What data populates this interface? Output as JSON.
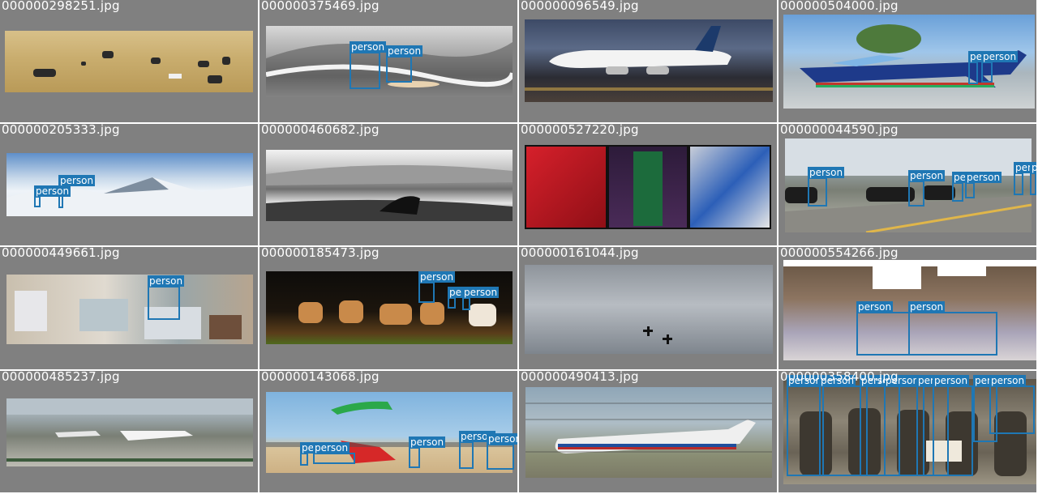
{
  "box_color": "#1f77b4",
  "cells": [
    {
      "filename": "000000298251.jpg",
      "detections": []
    },
    {
      "filename": "000000375469.jpg",
      "detections": [
        {
          "label": "person"
        },
        {
          "label": "person"
        }
      ]
    },
    {
      "filename": "000000096549.jpg",
      "detections": []
    },
    {
      "filename": "000000504000.jpg",
      "detections": [
        {
          "label": "person"
        },
        {
          "label": "person"
        }
      ]
    },
    {
      "filename": "000000205333.jpg",
      "detections": [
        {
          "label": "person"
        },
        {
          "label": "person"
        }
      ]
    },
    {
      "filename": "000000460682.jpg",
      "detections": []
    },
    {
      "filename": "000000527220.jpg",
      "detections": []
    },
    {
      "filename": "000000044590.jpg",
      "detections": [
        {
          "label": "person"
        },
        {
          "label": "person"
        },
        {
          "label": "person"
        },
        {
          "label": "person"
        },
        {
          "label": "person"
        },
        {
          "label": "person"
        }
      ]
    },
    {
      "filename": "000000449661.jpg",
      "detections": [
        {
          "label": "person"
        }
      ]
    },
    {
      "filename": "000000185473.jpg",
      "detections": [
        {
          "label": "person"
        },
        {
          "label": "person"
        },
        {
          "label": "person"
        }
      ]
    },
    {
      "filename": "000000161044.jpg",
      "detections": []
    },
    {
      "filename": "000000554266.jpg",
      "detections": [
        {
          "label": "person"
        },
        {
          "label": "person"
        }
      ]
    },
    {
      "filename": "000000485237.jpg",
      "detections": []
    },
    {
      "filename": "000000143068.jpg",
      "detections": [
        {
          "label": "person"
        },
        {
          "label": "person"
        },
        {
          "label": "person"
        },
        {
          "label": "person"
        },
        {
          "label": "person"
        }
      ]
    },
    {
      "filename": "000000490413.jpg",
      "detections": []
    },
    {
      "filename": "000000358400.jpg",
      "detections": [
        {
          "label": "person"
        },
        {
          "label": "person"
        },
        {
          "label": "person"
        },
        {
          "label": "person"
        },
        {
          "label": "person"
        },
        {
          "label": "person"
        },
        {
          "label": "person"
        },
        {
          "label": "person"
        }
      ]
    }
  ]
}
